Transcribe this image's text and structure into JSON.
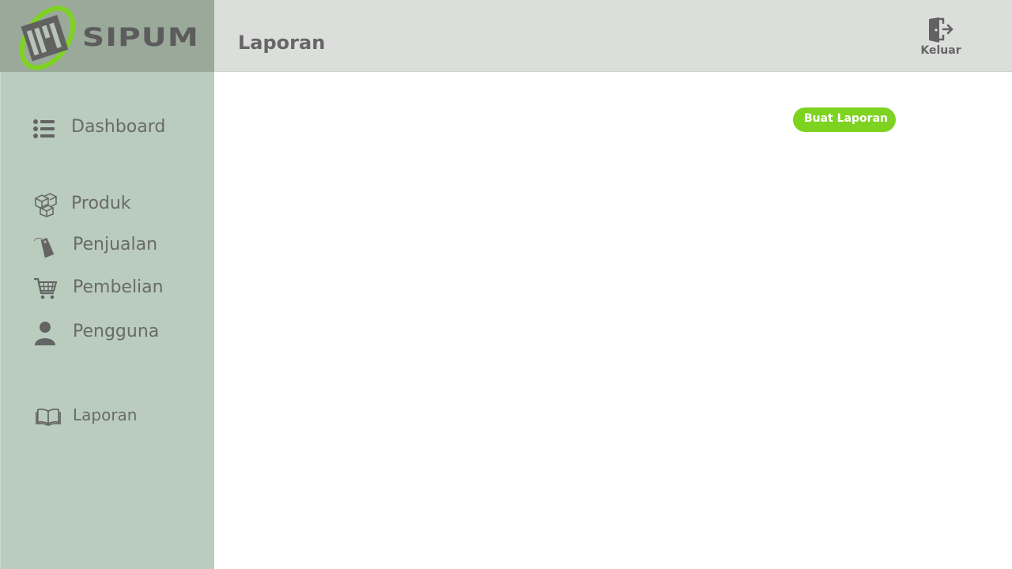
{
  "app": {
    "name": "SIPUM"
  },
  "header": {
    "title": "Laporan",
    "logout_label": "Keluar"
  },
  "sidebar": {
    "items": [
      {
        "label": "Dashboard",
        "icon": "list-icon"
      },
      {
        "label": "Produk",
        "icon": "boxes-icon"
      },
      {
        "label": "Penjualan",
        "icon": "tag-icon"
      },
      {
        "label": "Pembelian",
        "icon": "cart-icon"
      },
      {
        "label": "Pengguna",
        "icon": "user-icon"
      },
      {
        "label": "Laporan",
        "icon": "book-icon"
      }
    ]
  },
  "main": {
    "create_report_label": "Buat Laporan"
  },
  "colors": {
    "logo_bg": "#9aa99a",
    "topbar_bg": "#dcdedc",
    "sidebar_bg": "#b9ccbd",
    "accent": "#7ed321",
    "text": "#666666"
  }
}
